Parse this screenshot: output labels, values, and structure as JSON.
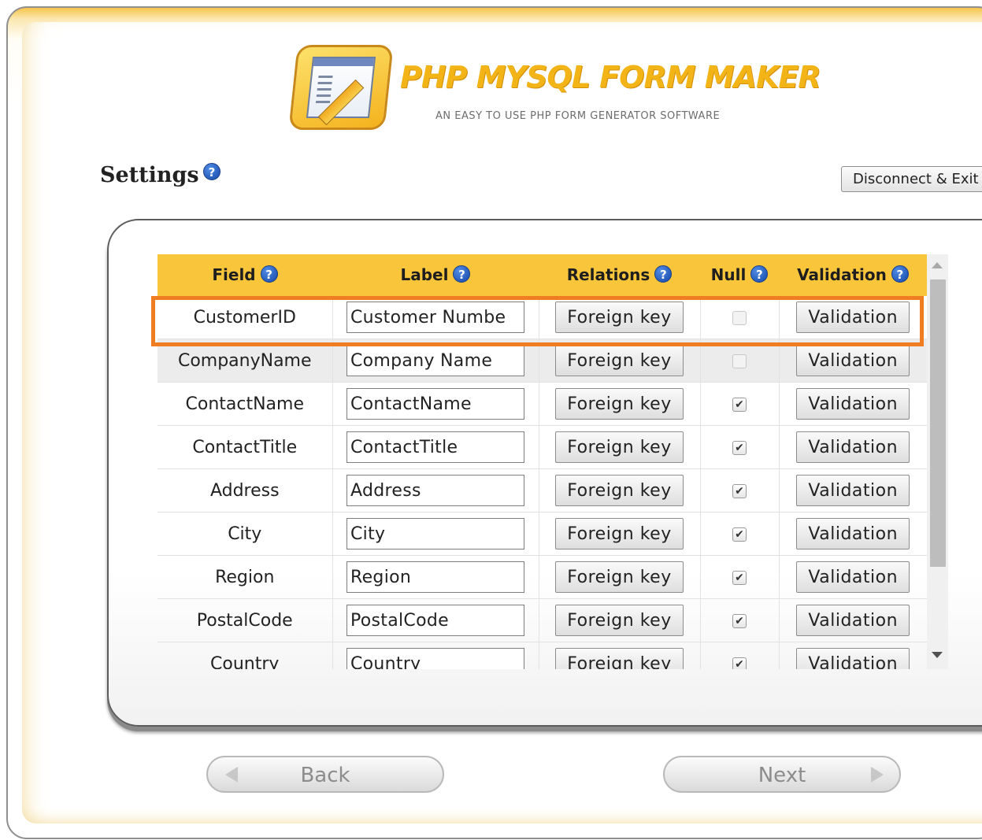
{
  "app": {
    "logo_title": "PHP MYSQL FORM MAKER",
    "logo_subtitle": "AN EASY TO USE PHP FORM GENERATOR SOFTWARE"
  },
  "page": {
    "title": "Settings",
    "help_glyph": "?",
    "disconnect_label": "Disconnect & Exit"
  },
  "table": {
    "headers": {
      "field": "Field",
      "label": "Label",
      "relations": "Relations",
      "null": "Null",
      "validation": "Validation"
    },
    "rows": [
      {
        "field": "CustomerID",
        "label": "Customer Numbe",
        "relations": "Foreign key",
        "null_checked": false,
        "null_disabled": true,
        "validation": "Validation"
      },
      {
        "field": "CompanyName",
        "label": "Company Name",
        "relations": "Foreign key",
        "null_checked": false,
        "null_disabled": true,
        "validation": "Validation"
      },
      {
        "field": "ContactName",
        "label": "ContactName",
        "relations": "Foreign key",
        "null_checked": true,
        "null_disabled": false,
        "validation": "Validation"
      },
      {
        "field": "ContactTitle",
        "label": "ContactTitle",
        "relations": "Foreign key",
        "null_checked": true,
        "null_disabled": false,
        "validation": "Validation"
      },
      {
        "field": "Address",
        "label": "Address",
        "relations": "Foreign key",
        "null_checked": true,
        "null_disabled": false,
        "validation": "Validation"
      },
      {
        "field": "City",
        "label": "City",
        "relations": "Foreign key",
        "null_checked": true,
        "null_disabled": false,
        "validation": "Validation"
      },
      {
        "field": "Region",
        "label": "Region",
        "relations": "Foreign key",
        "null_checked": true,
        "null_disabled": false,
        "validation": "Validation"
      },
      {
        "field": "PostalCode",
        "label": "PostalCode",
        "relations": "Foreign key",
        "null_checked": true,
        "null_disabled": false,
        "validation": "Validation"
      },
      {
        "field": "Country",
        "label": "Country",
        "relations": "Foreign key",
        "null_checked": true,
        "null_disabled": false,
        "validation": "Validation"
      }
    ]
  },
  "nav": {
    "back_label": "Back",
    "next_label": "Next"
  },
  "colors": {
    "header_bg": "#f9c63b",
    "highlight": "#f07d21",
    "logo_text": "#f2b417"
  }
}
